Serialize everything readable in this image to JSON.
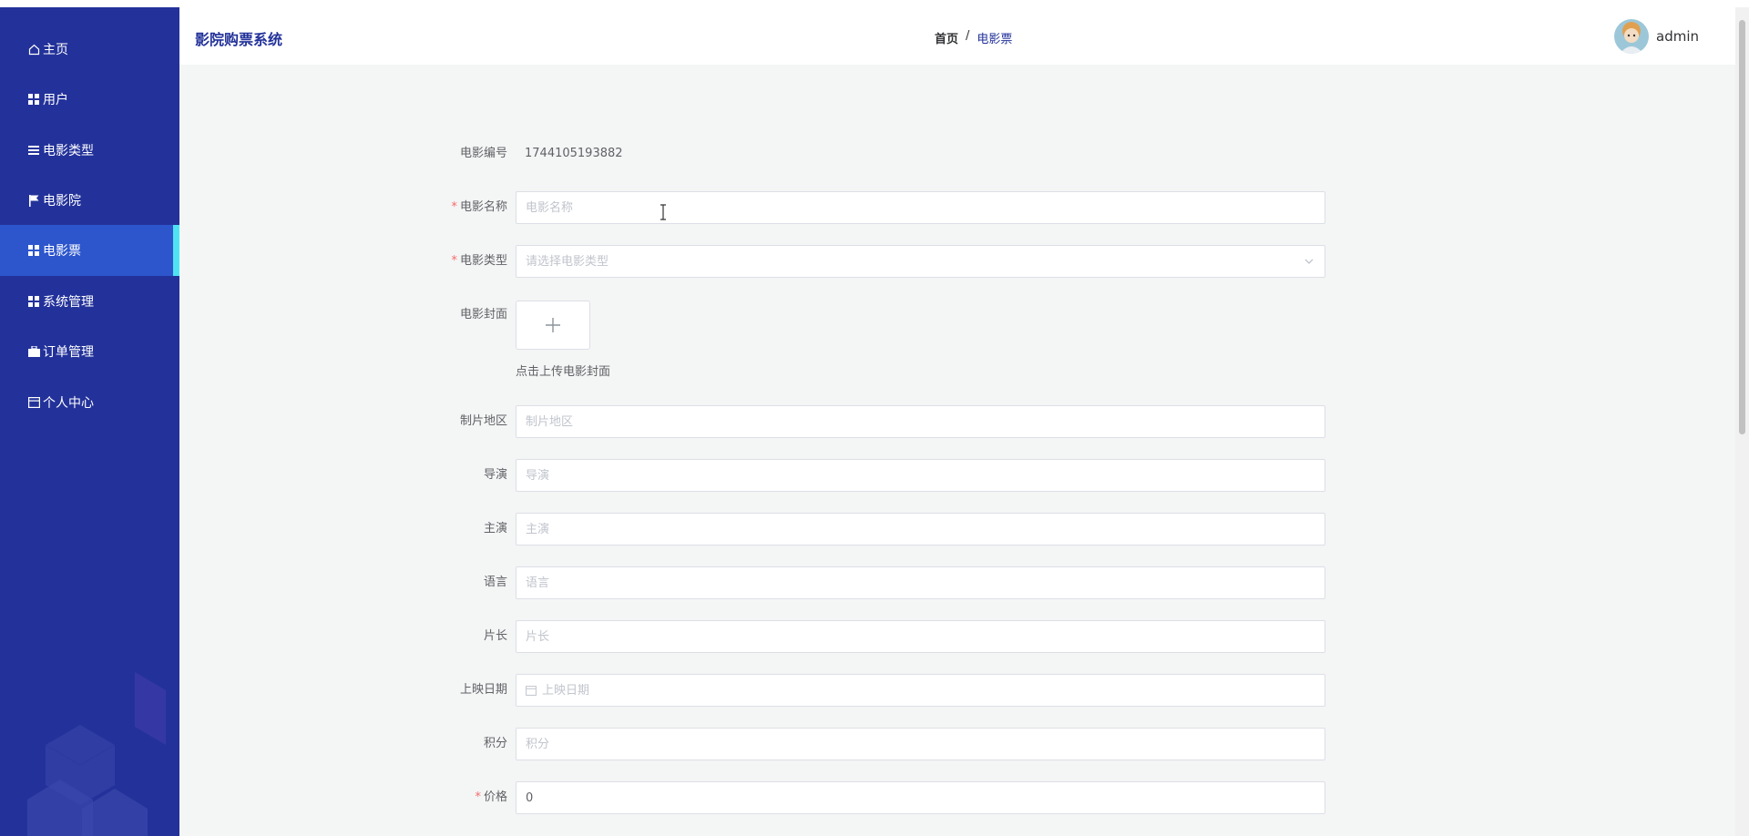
{
  "app": {
    "title": "影院购票系统"
  },
  "sidebar": {
    "items": [
      {
        "label": "主页",
        "icon": "home-icon"
      },
      {
        "label": "用户",
        "icon": "grid-icon"
      },
      {
        "label": "电影类型",
        "icon": "list-icon"
      },
      {
        "label": "电影院",
        "icon": "flag-icon"
      },
      {
        "label": "电影票",
        "icon": "grid-icon",
        "active": true
      },
      {
        "label": "系统管理",
        "icon": "grid-icon"
      },
      {
        "label": "订单管理",
        "icon": "briefcase-icon"
      },
      {
        "label": "个人中心",
        "icon": "card-icon"
      }
    ]
  },
  "header": {
    "breadcrumb": {
      "home": "首页",
      "separator": "/",
      "current": "电影票"
    },
    "user": {
      "name": "admin"
    }
  },
  "form": {
    "movie_id": {
      "label": "电影编号",
      "value": "1744105193882"
    },
    "movie_name": {
      "label": "电影名称",
      "placeholder": "电影名称",
      "required": true
    },
    "movie_type": {
      "label": "电影类型",
      "placeholder": "请选择电影类型",
      "required": true
    },
    "cover": {
      "label": "电影封面",
      "hint": "点击上传电影封面"
    },
    "region": {
      "label": "制片地区",
      "placeholder": "制片地区"
    },
    "director": {
      "label": "导演",
      "placeholder": "导演"
    },
    "actors": {
      "label": "主演",
      "placeholder": "主演"
    },
    "language": {
      "label": "语言",
      "placeholder": "语言"
    },
    "duration": {
      "label": "片长",
      "placeholder": "片长"
    },
    "release_date": {
      "label": "上映日期",
      "placeholder": "上映日期"
    },
    "points": {
      "label": "积分",
      "placeholder": "积分"
    },
    "price": {
      "label": "价格",
      "value": "0",
      "required": true
    }
  },
  "colors": {
    "sidebar_bg": "#23329a",
    "active_bg": "#2d56cd",
    "active_indicator": "#4fe3f2",
    "required": "#f56c6c"
  }
}
